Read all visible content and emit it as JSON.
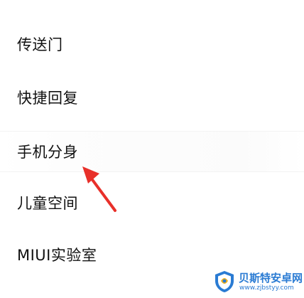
{
  "settings": {
    "items": [
      {
        "label": "传送门"
      },
      {
        "label": "快捷回复"
      },
      {
        "label": "手机分身"
      },
      {
        "label": "儿童空间"
      },
      {
        "label": "MIUI实验室"
      }
    ],
    "highlighted_index": 2
  },
  "annotation": {
    "icon": "red-arrow-icon",
    "color": "#e8302a"
  },
  "watermark": {
    "title": "贝斯特安卓网",
    "url": "www.zjbstyy.com",
    "brand_color": "#2a7bd3"
  }
}
